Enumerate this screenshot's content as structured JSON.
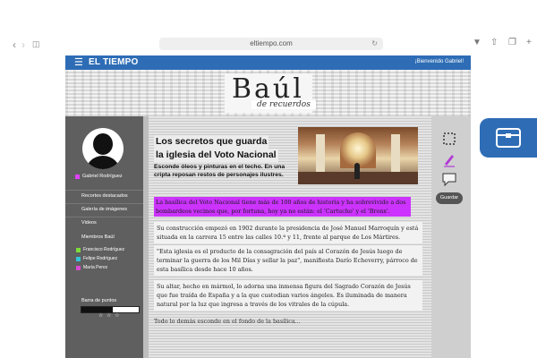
{
  "browser": {
    "url": "eltiempo.com",
    "reload_icon": "reload-icon"
  },
  "site": {
    "menu_icon": "hamburger-icon",
    "logo": "EL TIEMPO",
    "welcome": "¡Bienvenido Gabriel!"
  },
  "banner": {
    "title": "Baúl",
    "subtitle": "de recuerdos"
  },
  "sidebar": {
    "user_name": "Gabriel Rodríguez",
    "user_color": "#e040fb",
    "links": [
      "Recortes destacados",
      "Galería de imágenes",
      "Videos"
    ],
    "members_title": "Miembros Baúl",
    "members": [
      {
        "name": "Francisco Rodríguez",
        "color": "#7ddc3c"
      },
      {
        "name": "Felipe Rodríguez",
        "color": "#34c3d6"
      },
      {
        "name": "María Perez",
        "color": "#d84bd0"
      }
    ],
    "points_title": "Barra de puntos",
    "points_fraction": 0.55,
    "stars": "☆ ☆ ☆"
  },
  "article": {
    "title_line1": "Los secretos que guarda",
    "title_line2": "la iglesia del Voto Nacional",
    "subtitle": "Esconde óleos y pinturas en el techo. En una cripta reposan restos de personajes ilustres.",
    "highlight": "La basílica del Voto Nacional tiene más de 100 años de historia y ha sobrevivido a dos bombardeos vecinos que, por fortuna, hoy ya no están: el 'Cartucho' y el 'Bronx'.",
    "paragraphs": [
      "Su construcción empezó en 1902 durante la presidencia de José Manuel Marroquín y está situada en la carrera 15 entre las calles 10.ª y 11, frente al parque de Los Mártires.",
      "\"Esta iglesia es el producto de la consagración del país al Corazón de Jesús luego de terminar la guerra de los Mil Días y sellar la paz\", manifiesta Darío Echeverry, párroco de esta basílica desde hace 10 años.",
      "Su altar, hecho en mármol, lo adorna una inmensa figura del Sagrado Corazón de Jesús que fue traída de España y a la que custodian varios ángeles. Es iluminada de manera natural por la luz que ingresa a través de los vitrales de la cúpula."
    ],
    "cut_line": "Todo lo demás esconde en el fondo de la basílica..."
  },
  "tools": {
    "crop_icon": "crop-icon",
    "pen_icon": "pen-icon",
    "comment_icon": "comment-icon",
    "save_label": "Guardar"
  },
  "colors": {
    "brand_blue": "#2e6db5",
    "highlight": "#cc33ff"
  }
}
